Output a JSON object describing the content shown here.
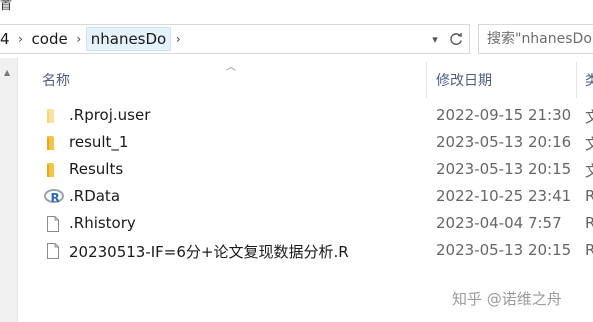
{
  "top_fragment": "首",
  "address": {
    "crumbs": [
      {
        "label": "4",
        "highlight": false
      },
      {
        "label": "code",
        "highlight": false
      },
      {
        "label": "nhanesDo",
        "highlight": true
      }
    ]
  },
  "search": {
    "placeholder": "搜索\"nhanesDo"
  },
  "columns": {
    "name": "名称",
    "date": "修改日期",
    "type": "类"
  },
  "files": [
    {
      "name": ".Rproj.user",
      "date": "2022-09-15 21:30",
      "type": "文",
      "icon": "folder-light-icon"
    },
    {
      "name": "result_1",
      "date": "2023-05-13 20:16",
      "type": "文",
      "icon": "folder-icon"
    },
    {
      "name": "Results",
      "date": "2023-05-13 20:15",
      "type": "文",
      "icon": "folder-icon"
    },
    {
      "name": ".RData",
      "date": "2022-10-25 23:41",
      "type": "R",
      "icon": "r-file-icon"
    },
    {
      "name": ".Rhistory",
      "date": "2023-04-04 7:57",
      "type": "R",
      "icon": "document-icon"
    },
    {
      "name": "20230513-IF=6分+论文复现数据分析.R",
      "date": "2023-05-13 20:15",
      "type": "R",
      "icon": "document-icon"
    }
  ],
  "watermark": "知乎 @诺维之舟",
  "colors": {
    "folder": "#f5c441",
    "folder_light": "#f8e2a0",
    "header_text": "#4d6082",
    "r_blue": "#2f6db3"
  }
}
